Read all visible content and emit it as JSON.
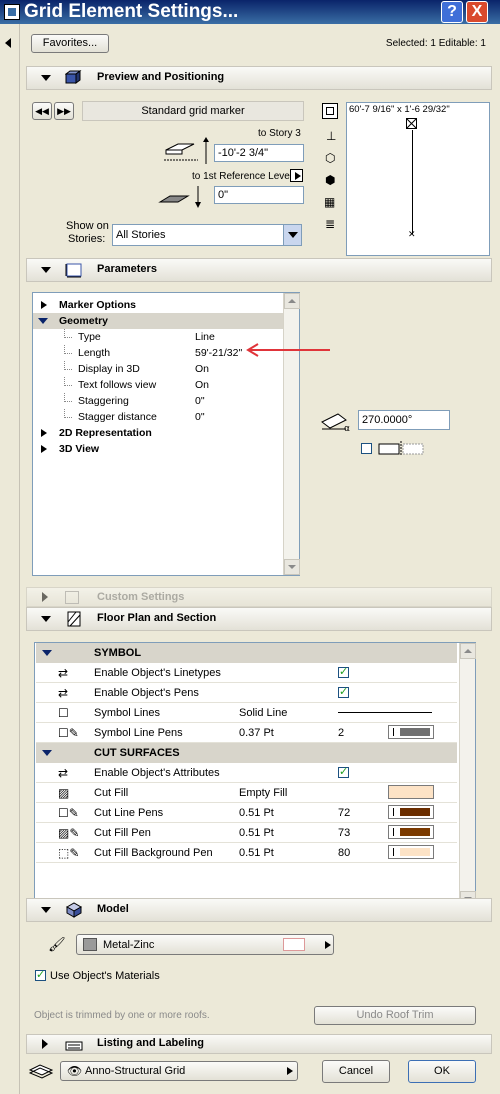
{
  "window": {
    "title": "Grid Element Settings...",
    "help_label": "?",
    "close_label": "X"
  },
  "header": {
    "favorites_label": "Favorites...",
    "selection_status": "Selected: 1 Editable: 1"
  },
  "preview": {
    "section_title": "Preview and Positioning",
    "marker_name": "Standard grid marker",
    "to_story_label": "to Story 3",
    "to_story_value": "-10'-2 3/4\"",
    "to_ref_label": "to 1st Reference Level",
    "to_ref_value": "0\"",
    "show_on_label_1": "Show on",
    "show_on_label_2": "Stories:",
    "stories_value": "All Stories",
    "dimension_text": "60'-7 9/16\" x 1'-6 29/32\""
  },
  "parameters": {
    "section_title": "Parameters",
    "tree": [
      {
        "label": "Marker Options",
        "value": "",
        "level": 0,
        "bold": true,
        "state": "collapsed"
      },
      {
        "label": "Geometry",
        "value": "",
        "level": 0,
        "bold": true,
        "state": "expanded"
      },
      {
        "label": "Type",
        "value": "Line",
        "level": 1
      },
      {
        "label": "Length",
        "value": "59'-21/32\"",
        "level": 1
      },
      {
        "label": "Display in 3D",
        "value": "On",
        "level": 1
      },
      {
        "label": "Text follows view",
        "value": "On",
        "level": 1
      },
      {
        "label": "Staggering",
        "value": "0\"",
        "level": 1
      },
      {
        "label": "Stagger distance",
        "value": "0\"",
        "level": 1
      },
      {
        "label": "2D Representation",
        "value": "",
        "level": 0,
        "bold": true,
        "state": "collapsed"
      },
      {
        "label": "3D View",
        "value": "",
        "level": 0,
        "bold": true,
        "state": "collapsed"
      }
    ],
    "angle_value": "270.0000°"
  },
  "custom_settings": {
    "section_title": "Custom Settings"
  },
  "floor_plan": {
    "section_title": "Floor Plan and Section",
    "symbol_header": "SYMBOL",
    "rows_symbol": [
      {
        "label": "Enable Object's Linetypes",
        "value": "",
        "extra": "",
        "checked": true
      },
      {
        "label": "Enable Object's Pens",
        "value": "",
        "extra": "",
        "checked": true
      },
      {
        "label": "Symbol Lines",
        "value": "Solid Line",
        "extra": ""
      },
      {
        "label": "Symbol Line Pens",
        "value": "0.37 Pt",
        "extra": "2"
      }
    ],
    "cut_header": "CUT SURFACES",
    "rows_cut": [
      {
        "label": "Enable Object's Attributes",
        "value": "",
        "extra": "",
        "checked": true
      },
      {
        "label": "Cut Fill",
        "value": "Empty Fill",
        "extra": ""
      },
      {
        "label": "Cut Line Pens",
        "value": "0.51 Pt",
        "extra": "72"
      },
      {
        "label": "Cut Fill Pen",
        "value": "0.51 Pt",
        "extra": "73"
      },
      {
        "label": "Cut Fill Background Pen",
        "value": "0.51 Pt",
        "extra": "80"
      }
    ]
  },
  "model": {
    "section_title": "Model",
    "material": "Metal-Zinc",
    "use_materials_label": "Use Object's Materials",
    "trim_notice": "Object is trimmed by one or more roofs.",
    "undo_trim_label": "Undo Roof Trim"
  },
  "listing": {
    "section_title": "Listing and Labeling"
  },
  "footer": {
    "layer_name": "Anno-Structural Grid",
    "cancel_label": "Cancel",
    "ok_label": "OK"
  },
  "colors": {
    "title_bar": "#0a246a",
    "cut_line_pen": "#6b2e00",
    "cut_fill_pen": "#7a3a00",
    "cut_fill_bg": "#fde3c6",
    "annotation_arrow": "#e0343a"
  }
}
